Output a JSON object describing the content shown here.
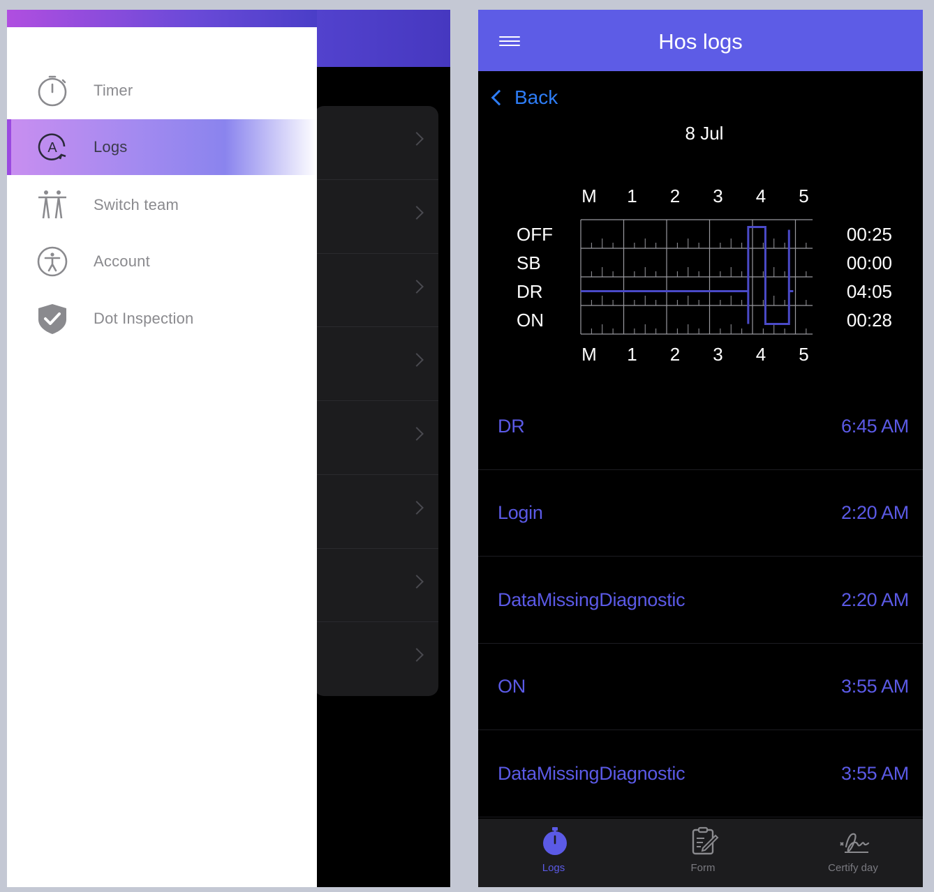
{
  "left": {
    "menu": [
      {
        "label": "Timer",
        "icon": "timer-icon"
      },
      {
        "label": "Logs",
        "icon": "logs-icon",
        "active": true
      },
      {
        "label": "Switch team",
        "icon": "switch-team-icon"
      },
      {
        "label": "Account",
        "icon": "account-icon"
      },
      {
        "label": "Dot Inspection",
        "icon": "shield-check-icon"
      }
    ]
  },
  "right": {
    "header": {
      "title": "Hos logs",
      "menu_icon": "hamburger-icon"
    },
    "back_label": "Back",
    "date": "8 Jul",
    "graph": {
      "hour_labels": [
        "M",
        "1",
        "2",
        "3",
        "4",
        "5"
      ],
      "status_labels": [
        "OFF",
        "SB",
        "DR",
        "ON"
      ],
      "totals": [
        "00:25",
        "00:00",
        "04:05",
        "00:28"
      ],
      "line_color": "#4a4ac8"
    },
    "logs": [
      {
        "name": "DR",
        "time": "6:45 AM"
      },
      {
        "name": "Login",
        "time": "2:20 AM"
      },
      {
        "name": "DataMissingDiagnostic",
        "time": "2:20 AM"
      },
      {
        "name": "ON",
        "time": "3:55 AM"
      },
      {
        "name": "DataMissingDiagnostic",
        "time": "3:55 AM"
      }
    ],
    "tabs": [
      {
        "label": "Logs",
        "icon": "stopwatch-icon",
        "active": true
      },
      {
        "label": "Form",
        "icon": "form-icon"
      },
      {
        "label": "Certify day",
        "icon": "signature-icon"
      }
    ]
  },
  "colors": {
    "accent": "#5d5ce6",
    "link": "#2e7df6",
    "drawer_active": "#9a4ae0"
  }
}
